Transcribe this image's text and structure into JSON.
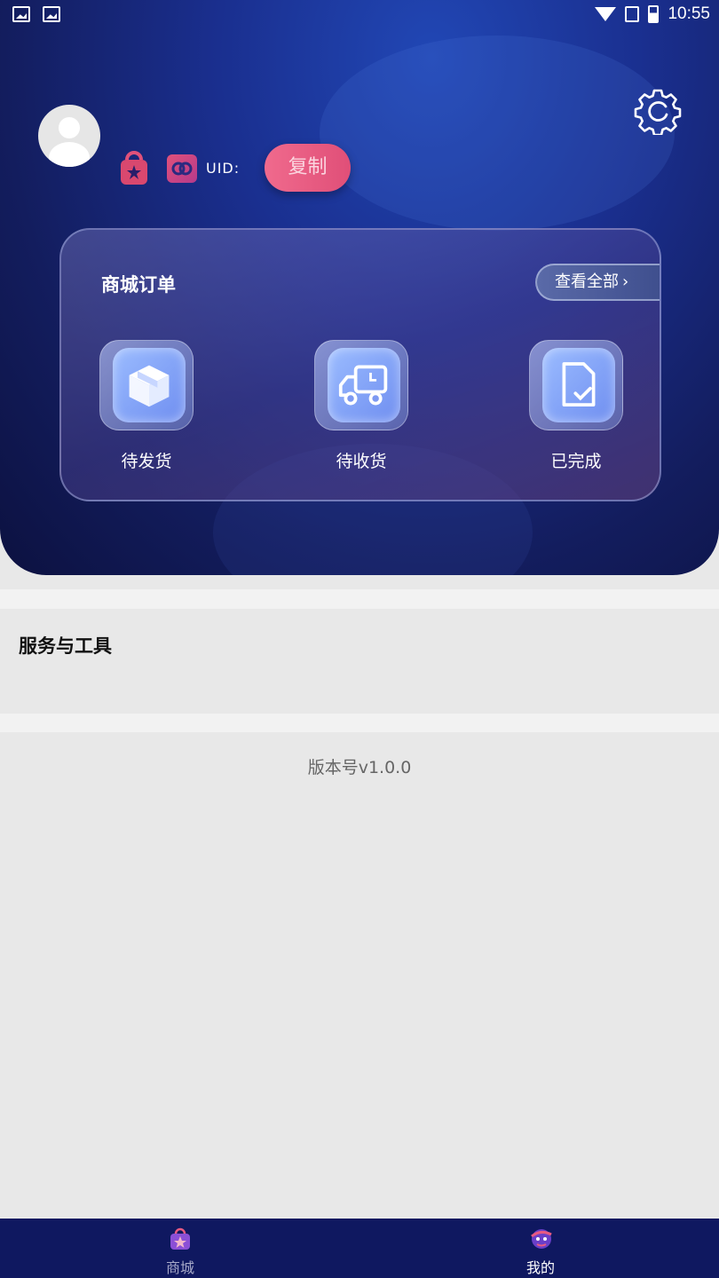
{
  "status_bar": {
    "time": "10:55"
  },
  "profile": {
    "uid_label": "UID:",
    "copy_label": "复制"
  },
  "orders": {
    "title": "商城订单",
    "view_all_label": "查看全部",
    "items": [
      {
        "label": "待发货",
        "icon": "package-box-icon"
      },
      {
        "label": "待收货",
        "icon": "delivery-truck-icon"
      },
      {
        "label": "已完成",
        "icon": "document-check-icon"
      }
    ]
  },
  "tools": {
    "title": "服务与工具"
  },
  "version": "版本号v1.0.0",
  "tabbar": {
    "items": [
      {
        "label": "商城",
        "active": false
      },
      {
        "label": "我的",
        "active": true
      }
    ]
  },
  "colors": {
    "header_blue": "#1a2f8f",
    "copy_button": "#e85a81",
    "tabbar_bg": "#0f1860"
  }
}
